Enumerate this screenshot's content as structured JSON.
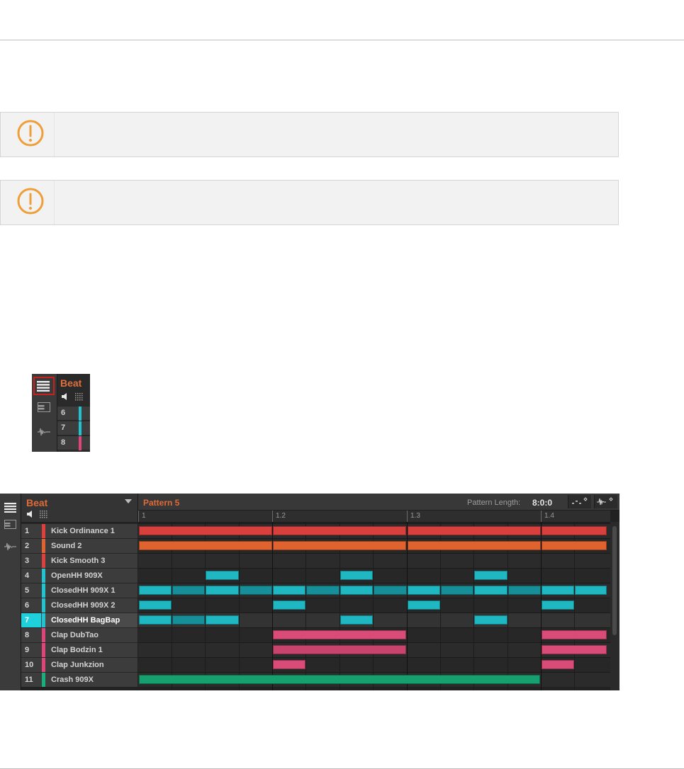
{
  "notes": [
    {
      "icon": "exclamation-circle-icon"
    },
    {
      "icon": "exclamation-circle-icon"
    }
  ],
  "inset": {
    "title": "Beat",
    "rows": [
      {
        "num": "6",
        "color": "#1fc4d0"
      },
      {
        "num": "7",
        "color": "#1fc4d0"
      },
      {
        "num": "8",
        "color": "#e0457a"
      }
    ]
  },
  "editor": {
    "group_title": "Beat",
    "pattern_name": "Pattern 5",
    "pattern_length_label": "Pattern Length:",
    "pattern_length_value": "8:0:0",
    "ruler": [
      "1",
      "1.2",
      "1.3",
      "1.4"
    ],
    "colors": {
      "red": "#d7403c",
      "orange": "#e0622f",
      "cyan": "#1fb8c2",
      "cyan_dark": "#178f99",
      "pink": "#d94c78",
      "green": "#16a06f",
      "accent": "#e06a38"
    },
    "sounds": [
      {
        "num": "1",
        "name": "Kick Ordinance 1",
        "color": "#e0403c"
      },
      {
        "num": "2",
        "name": "Sound 2",
        "color": "#e2622f"
      },
      {
        "num": "3",
        "name": "Kick Smooth 3",
        "color": "#e0403c"
      },
      {
        "num": "4",
        "name": "OpenHH 909X",
        "color": "#1fc4d0"
      },
      {
        "num": "5",
        "name": "ClosedHH 909X 1",
        "color": "#1fc4d0"
      },
      {
        "num": "6",
        "name": "ClosedHH 909X 2",
        "color": "#1fc4d0"
      },
      {
        "num": "7",
        "name": "ClosedHH BagBap",
        "color": "#1fc4d0",
        "selected": true
      },
      {
        "num": "8",
        "name": "Clap DubTao",
        "color": "#e0457a"
      },
      {
        "num": "9",
        "name": "Clap Bodzin 1",
        "color": "#e0457a"
      },
      {
        "num": "10",
        "name": "Clap Junkzion",
        "color": "#e0457a"
      },
      {
        "num": "11",
        "name": "Crash 909X",
        "color": "#16b07a"
      }
    ]
  }
}
